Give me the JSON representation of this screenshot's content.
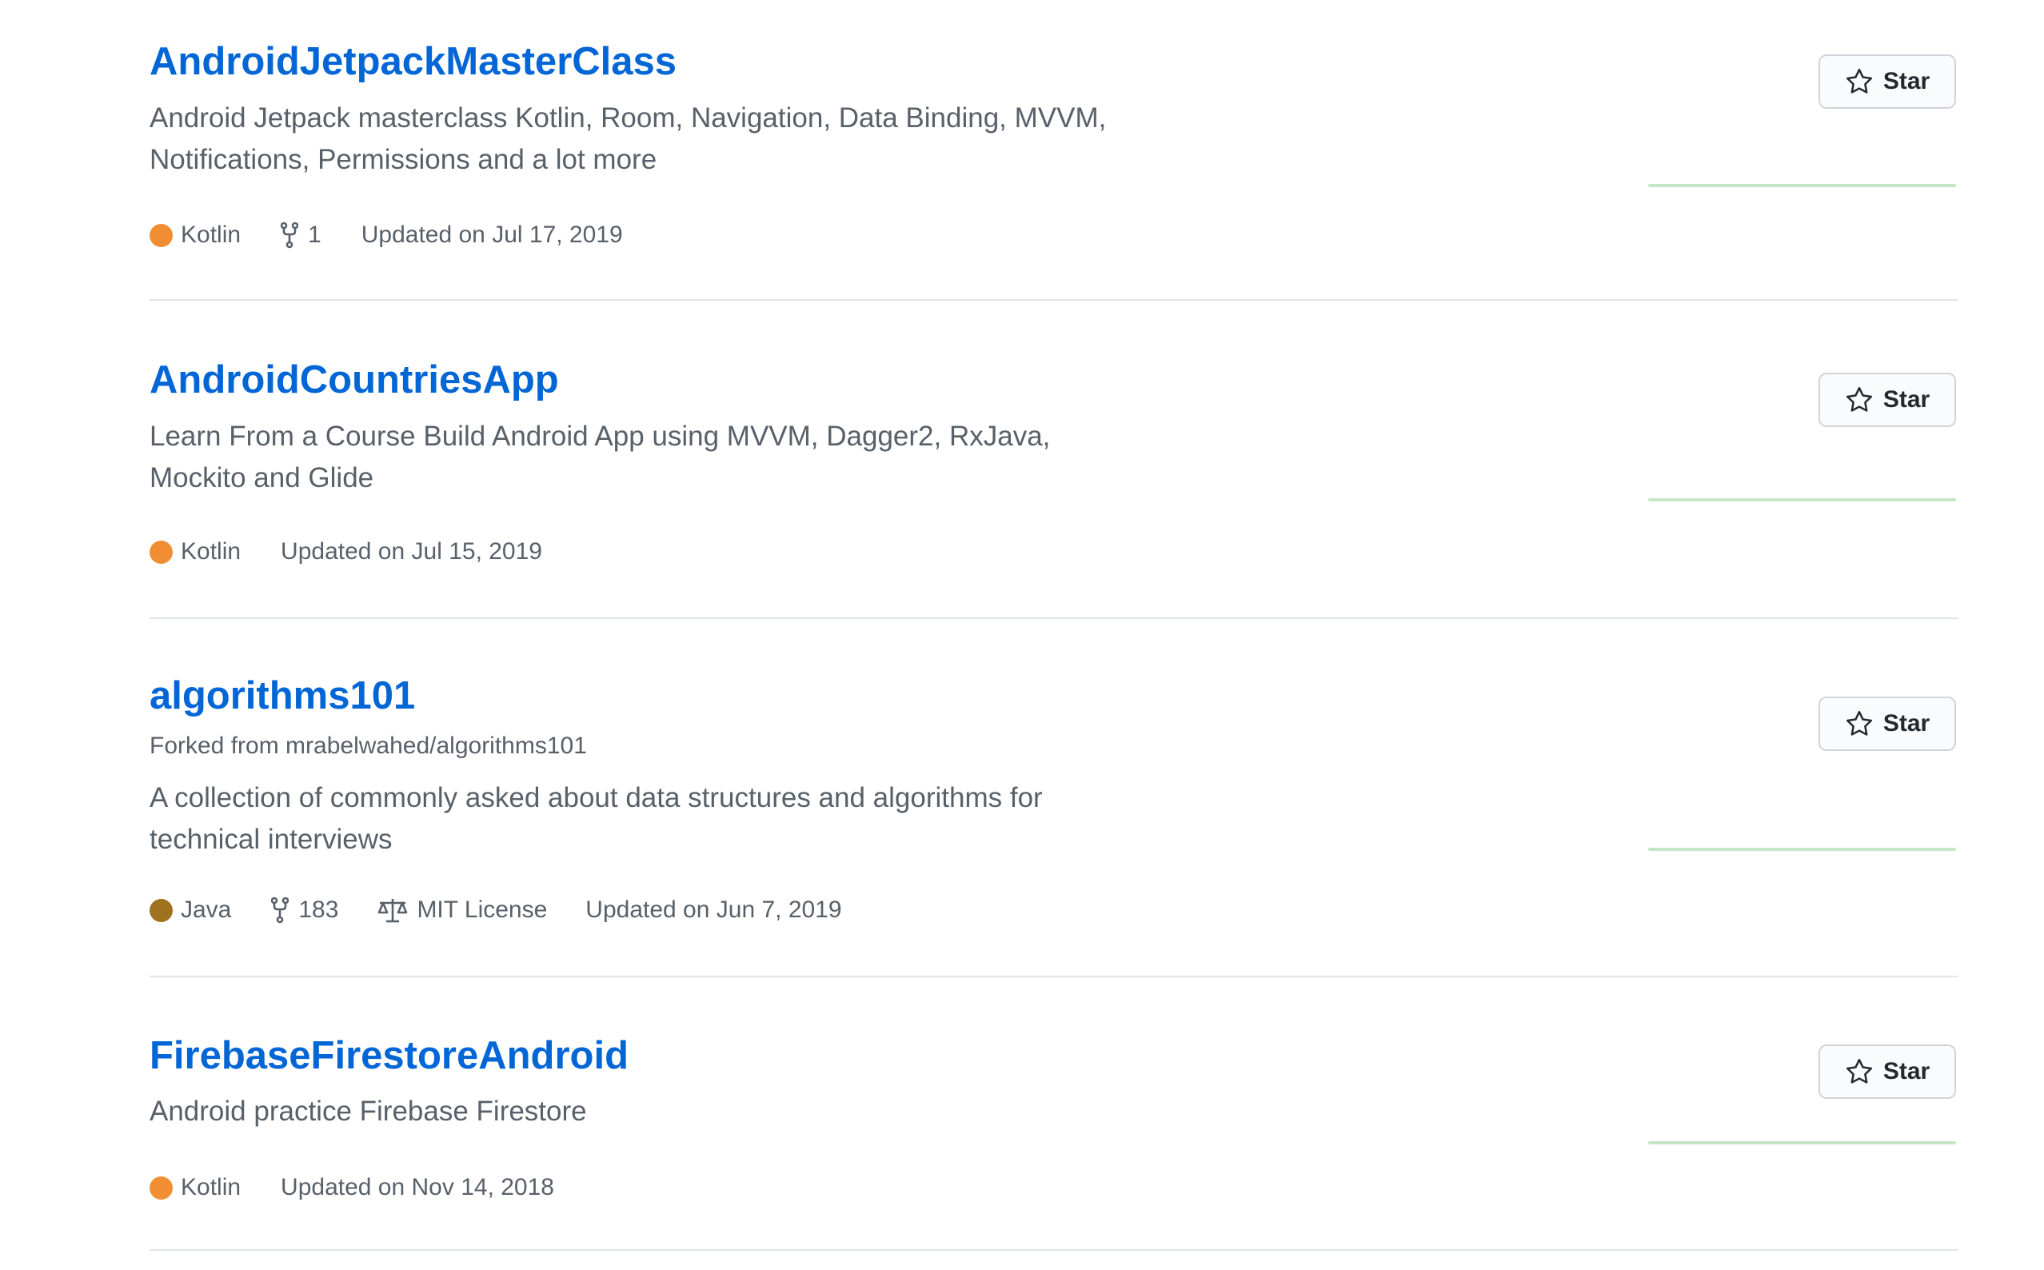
{
  "repos": [
    {
      "name": "AndroidJetpackMasterClass",
      "description": "Android Jetpack masterclass Kotlin, Room, Navigation, Data Binding, MVVM, Notifications, Permissions and a lot more",
      "language": "Kotlin",
      "language_color": "#F18E33",
      "forks": "1",
      "updated": "Updated on Jul 17, 2019",
      "star_label": "Star"
    },
    {
      "name": "AndroidCountriesApp",
      "description": "Learn From a Course Build Android App using MVVM, Dagger2, RxJava, Mockito and Glide",
      "language": "Kotlin",
      "language_color": "#F18E33",
      "updated": "Updated on Jul 15, 2019",
      "star_label": "Star"
    },
    {
      "name": "algorithms101",
      "forked_from": "Forked from mrabelwahed/algorithms101",
      "description": "A collection of commonly asked about data structures and algorithms for technical interviews",
      "language": "Java",
      "language_color": "#B07219",
      "forks": "183",
      "license": "MIT License",
      "updated": "Updated on Jun 7, 2019",
      "star_label": "Star"
    },
    {
      "name": "FirebaseFirestoreAndroid",
      "description": "Android practice Firebase Firestore",
      "language": "Kotlin",
      "language_color": "#F18E33",
      "updated": "Updated on Nov 14, 2018",
      "star_label": "Star"
    }
  ],
  "colors": {
    "link": "#0366d6",
    "muted": "#586069",
    "border": "#e1e4e8",
    "sparkline": "#c6e6c6"
  }
}
